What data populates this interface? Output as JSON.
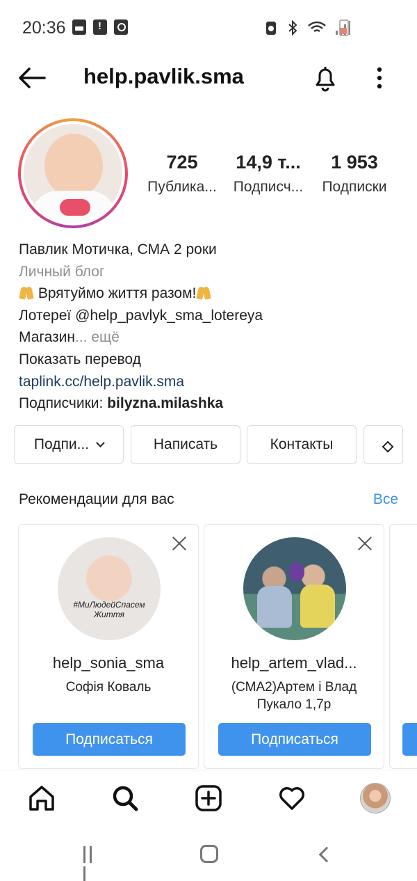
{
  "status_bar": {
    "time": "20:36"
  },
  "header": {
    "username": "help.pavlik.sma"
  },
  "stats": [
    {
      "value": "725",
      "label": "Публика..."
    },
    {
      "value": "14,9 т...",
      "label": "Подписч..."
    },
    {
      "value": "1 953",
      "label": "Подписки"
    }
  ],
  "bio": {
    "name": "Павлик Мотичка, СМА 2 роки",
    "category": "Личный блог",
    "line1": " Врятуймо життя разом!",
    "line2": "Лотереї @help_pavlyk_sma_lotereya",
    "line3": "Магазин",
    "more": "... ещё",
    "translate": "Показать перевод",
    "link": "taplink.cc/help.pavlik.sma",
    "followers_prefix": "Подписчики: ",
    "followers_name": "bilyzna.milashka"
  },
  "buttons": {
    "follow": "Подпи...",
    "message": "Написать",
    "contacts": "Контакты"
  },
  "recommendations": {
    "title": "Рекомендации для вас",
    "see_all": "Все",
    "cards": [
      {
        "username": "help_sonia_sma",
        "subtitle": "Софія Коваль",
        "hashtag": "#МиЛюдейСпасем Життя",
        "follow": "Подписаться"
      },
      {
        "username": "help_artem_vlad...",
        "subtitle": "(СМА2)Артем і Влад Пукало 1,7р",
        "follow": "Подписаться"
      }
    ]
  },
  "icons": {
    "back": "arrow-left-icon",
    "bell": "bell-icon",
    "more": "more-vertical-icon",
    "home": "home-icon",
    "search": "search-icon",
    "add": "plus-square-icon",
    "activity": "heart-icon"
  },
  "colors": {
    "accent": "#4093ec",
    "link": "#1d3a60",
    "muted": "#8e8e8e"
  }
}
